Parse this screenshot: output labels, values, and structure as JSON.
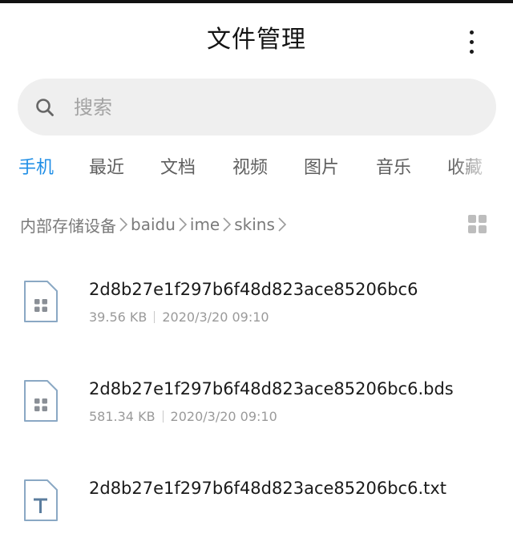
{
  "app": {
    "title": "文件管理"
  },
  "search": {
    "placeholder": "搜索",
    "value": ""
  },
  "tabs": [
    {
      "label": "手机",
      "active": true
    },
    {
      "label": "最近",
      "active": false
    },
    {
      "label": "文档",
      "active": false
    },
    {
      "label": "视频",
      "active": false
    },
    {
      "label": "图片",
      "active": false
    },
    {
      "label": "音乐",
      "active": false
    },
    {
      "label": "收藏",
      "active": false
    }
  ],
  "breadcrumb": [
    "内部存储设备",
    "baidu",
    "ime",
    "skins"
  ],
  "files": [
    {
      "name": "2d8b27e1f297b6f48d823ace85206bc6",
      "size": "39.56 KB",
      "date": "2020/3/20 09:10",
      "icon": "unknown-file-icon"
    },
    {
      "name": "2d8b27e1f297b6f48d823ace85206bc6.bds",
      "size": "581.34 KB",
      "date": "2020/3/20 09:10",
      "icon": "unknown-file-icon"
    },
    {
      "name": "2d8b27e1f297b6f48d823ace85206bc6.txt",
      "size": "",
      "date": "",
      "icon": "text-file-icon"
    }
  ],
  "colors": {
    "accent": "#1f8ee6",
    "tab_inactive": "#5f5f5f",
    "search_bg": "#efefef",
    "icon_stroke": "#8aa8c4",
    "text_primary": "#1a1a1a",
    "text_secondary": "#9a9a9a"
  }
}
